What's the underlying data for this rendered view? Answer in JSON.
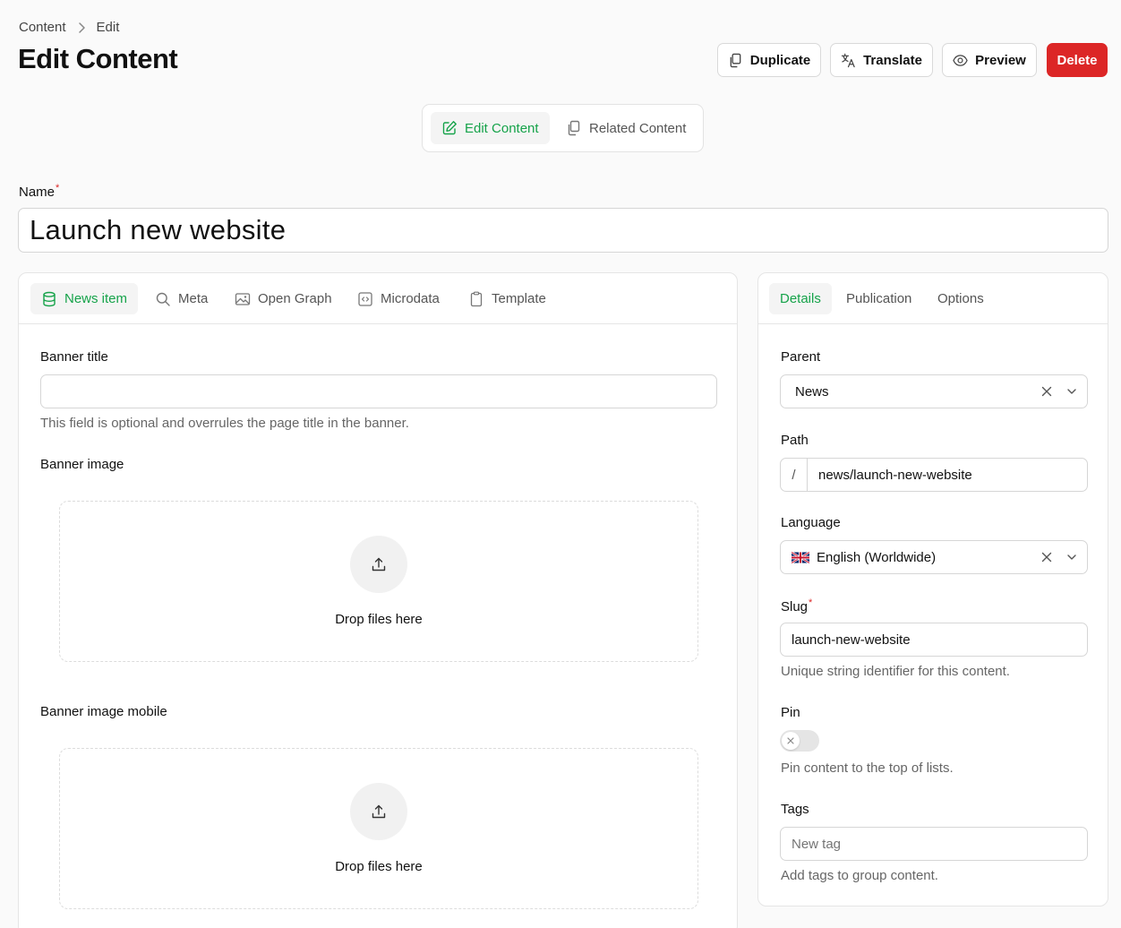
{
  "breadcrumb": {
    "items": [
      "Content",
      "Edit"
    ]
  },
  "header": {
    "title": "Edit Content",
    "buttons": {
      "duplicate": "Duplicate",
      "translate": "Translate",
      "preview": "Preview",
      "delete": "Delete"
    },
    "danger_color": "#dc2626"
  },
  "segnav": {
    "edit": "Edit Content",
    "related": "Related Content"
  },
  "name_field": {
    "label": "Name",
    "value": "Launch new website"
  },
  "left_panel": {
    "tabs": [
      "News item",
      "Meta",
      "Open Graph",
      "Microdata",
      "Template"
    ],
    "banner_title": {
      "label": "Banner title",
      "value": "",
      "help": "This field is optional and overrules the page title in the banner."
    },
    "banner_image": {
      "label": "Banner image",
      "drop_text": "Drop files here"
    },
    "banner_image_mobile": {
      "label": "Banner image mobile",
      "drop_text": "Drop files here"
    }
  },
  "right_panel": {
    "tabs": [
      "Details",
      "Publication",
      "Options"
    ],
    "parent": {
      "label": "Parent",
      "value": "News"
    },
    "path": {
      "label": "Path",
      "prefix": "/",
      "value": "news/launch-new-website"
    },
    "language": {
      "label": "Language",
      "value": "English (Worldwide)"
    },
    "slug": {
      "label": "Slug",
      "value": "launch-new-website",
      "help": "Unique string identifier for this content."
    },
    "pin": {
      "label": "Pin",
      "enabled": false,
      "help": "Pin content to the top of lists."
    },
    "tags": {
      "label": "Tags",
      "placeholder": "New tag",
      "help": "Add tags to group content."
    }
  },
  "accent_color": "#16a34a"
}
